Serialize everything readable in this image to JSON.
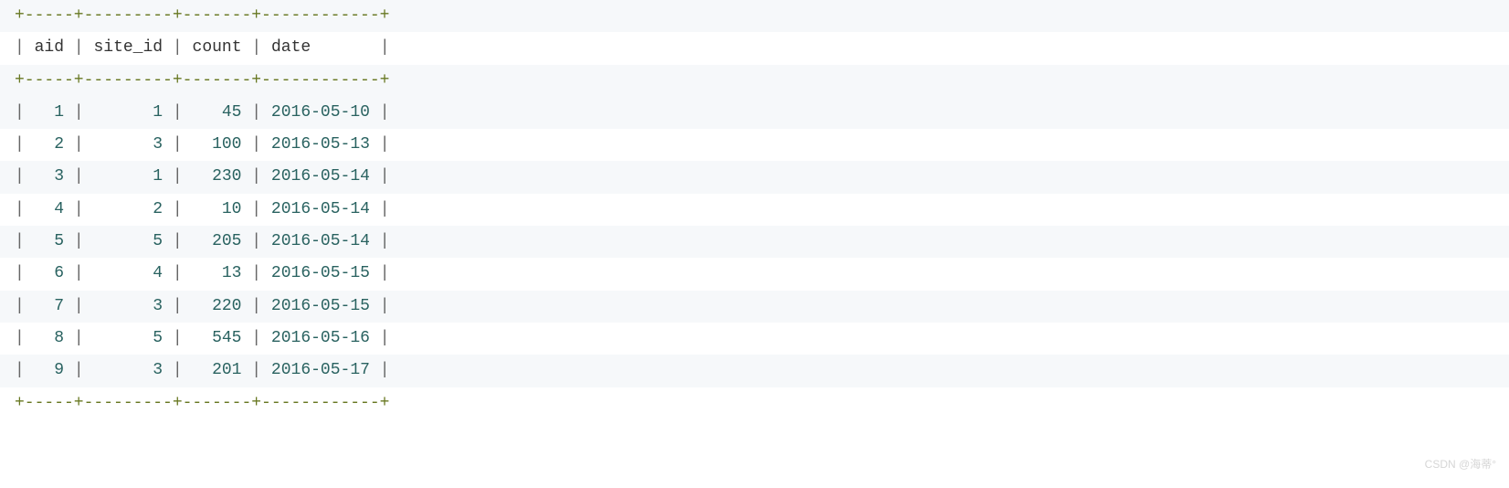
{
  "border_top": "+-----+---------+-------+------------+",
  "border_mid": "+-----+---------+-------+------------+",
  "border_bot": "+-----+---------+-------+------------+",
  "headers": {
    "aid": "aid",
    "site_id": "site_id",
    "count": "count",
    "date": "date"
  },
  "rows": [
    {
      "aid": "1",
      "site_id": "1",
      "count": "45",
      "date": "2016-05-10"
    },
    {
      "aid": "2",
      "site_id": "3",
      "count": "100",
      "date": "2016-05-13"
    },
    {
      "aid": "3",
      "site_id": "1",
      "count": "230",
      "date": "2016-05-14"
    },
    {
      "aid": "4",
      "site_id": "2",
      "count": "10",
      "date": "2016-05-14"
    },
    {
      "aid": "5",
      "site_id": "5",
      "count": "205",
      "date": "2016-05-14"
    },
    {
      "aid": "6",
      "site_id": "4",
      "count": "13",
      "date": "2016-05-15"
    },
    {
      "aid": "7",
      "site_id": "3",
      "count": "220",
      "date": "2016-05-15"
    },
    {
      "aid": "8",
      "site_id": "5",
      "count": "545",
      "date": "2016-05-16"
    },
    {
      "aid": "9",
      "site_id": "3",
      "count": "201",
      "date": "2016-05-17"
    }
  ],
  "watermark": "CSDN @海蒂°"
}
